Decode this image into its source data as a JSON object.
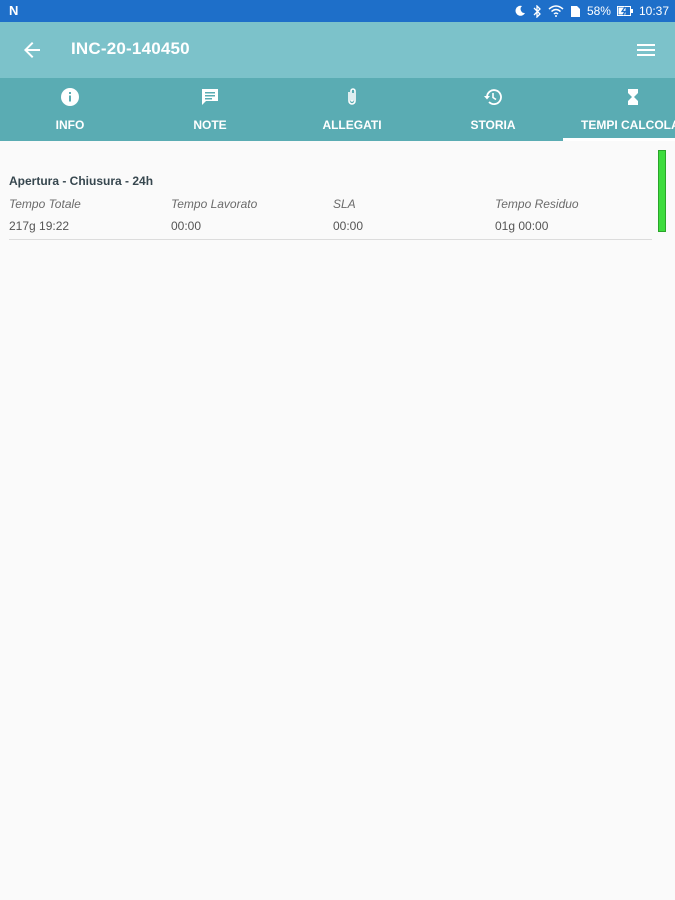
{
  "status_bar": {
    "logo": "N",
    "battery": "58%",
    "time": "10:37"
  },
  "app_bar": {
    "title": "INC-20-140450"
  },
  "tabs": [
    {
      "label": "INFO",
      "icon": "info-icon"
    },
    {
      "label": "NOTE",
      "icon": "comment-icon"
    },
    {
      "label": "ALLEGATI",
      "icon": "paperclip-icon"
    },
    {
      "label": "STORIA",
      "icon": "history-icon"
    },
    {
      "label": "TEMPI CALCOLA",
      "icon": "hourglass-icon",
      "active": true
    }
  ],
  "timing_card": {
    "title": "Apertura - Chiusura - 24h",
    "columns": [
      {
        "label": "Tempo Totale",
        "value": "217g 19:22"
      },
      {
        "label": "Tempo Lavorato",
        "value": "00:00"
      },
      {
        "label": "SLA",
        "value": "00:00"
      },
      {
        "label": "Tempo Residuo",
        "value": "01g 00:00"
      }
    ],
    "status_color": "#3ddc3d"
  },
  "colors": {
    "status_bar": "#1e6fc9",
    "app_bar": "#7cc2ca",
    "tab_bar": "#5aacb3"
  }
}
